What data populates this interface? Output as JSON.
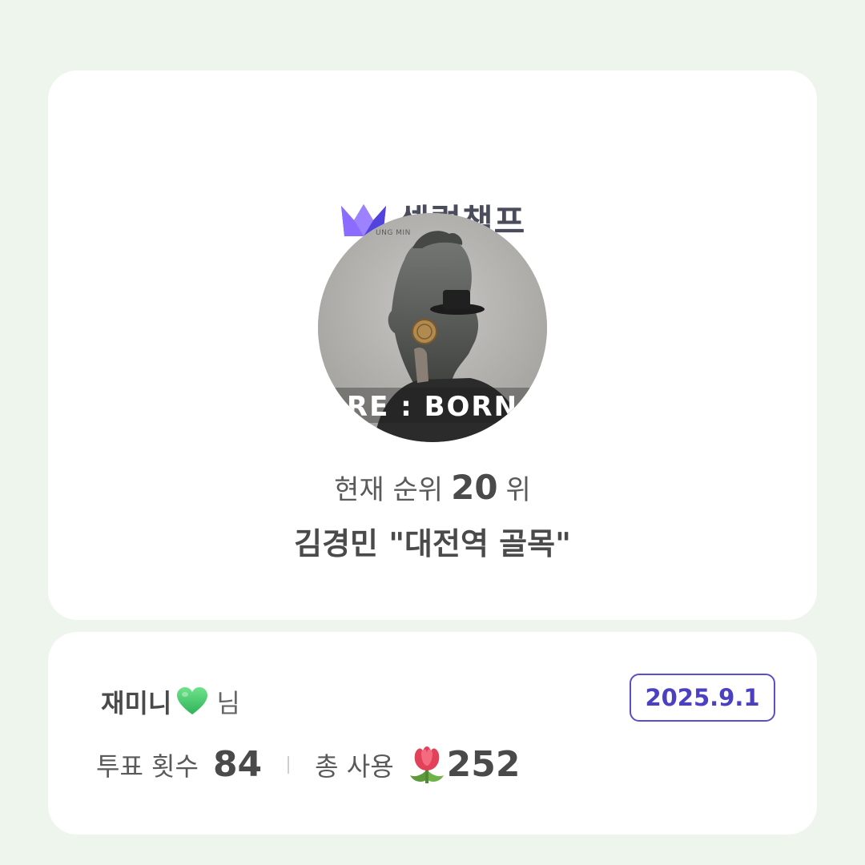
{
  "brand": {
    "name": "셀럽챔프",
    "icon": "crown-icon",
    "icon_colors": [
      "#7f5cf5",
      "#5b4ee6",
      "#9a79ff"
    ]
  },
  "artwork": {
    "caption": "UNG MIN",
    "title": "RE : BORN"
  },
  "rank": {
    "label": "현재 순위",
    "value": "20",
    "unit": "위"
  },
  "song": {
    "title": "김경민 \"대전역 골목\""
  },
  "user": {
    "name": "재미니",
    "emoji_icon": "green-heart-icon",
    "suffix": "님"
  },
  "date": "2025.9.1",
  "stats": {
    "votes_label": "투표 횟수",
    "votes_value": "84",
    "total_label": "총 사용",
    "total_icon": "tulip-icon",
    "total_value": "252"
  },
  "colors": {
    "background": "#eef5ec",
    "card": "#ffffff",
    "accent": "#5a4fc8",
    "text": "#4a4a4a"
  }
}
